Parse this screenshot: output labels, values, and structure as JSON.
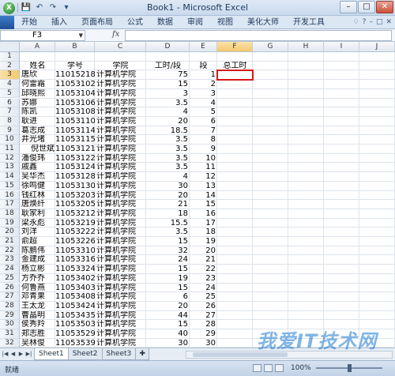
{
  "window": {
    "title": "Book1 - Microsoft Excel",
    "logo_letter": "X",
    "controls": {
      "minimize": "–",
      "maximize": "□",
      "close": "✕"
    }
  },
  "quick_access": {
    "save": "💾",
    "undo": "↶",
    "redo": "↷",
    "more": "▾"
  },
  "ribbon": {
    "tabs": [
      "开始",
      "插入",
      "页面布局",
      "公式",
      "数据",
      "审阅",
      "视图",
      "美化大师",
      "开发工具"
    ],
    "right_icons": [
      "♢",
      "?",
      "–",
      "□",
      "✕"
    ]
  },
  "formula_bar": {
    "name_box": "F3",
    "fx_label": "fx",
    "formula": ""
  },
  "columns": [
    "A",
    "B",
    "C",
    "D",
    "E",
    "F",
    "G",
    "H",
    "I",
    "J"
  ],
  "selected_column": "F",
  "selected_row": 3,
  "rows": [
    [
      "",
      "",
      "",
      "",
      "",
      ""
    ],
    [
      "姓名",
      "学号",
      "学院",
      "工时/段",
      "段",
      "总工时"
    ],
    [
      "唐欣",
      "11015218",
      "计算机学院",
      "75",
      "1",
      ""
    ],
    [
      "何雷霜",
      "11053102",
      "计算机学院",
      "15",
      "2",
      ""
    ],
    [
      "邱晓熙",
      "11053104",
      "计算机学院",
      "3",
      "3",
      ""
    ],
    [
      "苏娜",
      "11053106",
      "计算机学院",
      "3.5",
      "4",
      ""
    ],
    [
      "陈凯",
      "11053108",
      "计算机学院",
      "4",
      "5",
      ""
    ],
    [
      "耿进",
      "11053110",
      "计算机学院",
      "20",
      "6",
      ""
    ],
    [
      "葛志成",
      "11053114",
      "计算机学院",
      "18.5",
      "7",
      ""
    ],
    [
      "井光堵",
      "11053115",
      "计算机学院",
      "3.5",
      "8",
      ""
    ],
    [
      "倪世斌",
      "11053121",
      "计算机学院",
      "3.5",
      "9",
      ""
    ],
    [
      "潘俊玮",
      "11053122",
      "计算机学院",
      "3.5",
      "10",
      ""
    ],
    [
      "戚鑫",
      "11053124",
      "计算机学院",
      "3.5",
      "11",
      ""
    ],
    [
      "吴华杰",
      "11053128",
      "计算机学院",
      "4",
      "12",
      ""
    ],
    [
      "徐鸣健",
      "11053130",
      "计算机学院",
      "30",
      "13",
      ""
    ],
    [
      "钱红林",
      "11053203",
      "计算机学院",
      "20",
      "14",
      ""
    ],
    [
      "唐焕纤",
      "11053205",
      "计算机学院",
      "21",
      "15",
      ""
    ],
    [
      "耿家利",
      "11053212",
      "计算机学院",
      "18",
      "16",
      ""
    ],
    [
      "梁永彪",
      "11053219",
      "计算机学院",
      "15.5",
      "17",
      ""
    ],
    [
      "刘洋",
      "11053222",
      "计算机学院",
      "3.5",
      "18",
      ""
    ],
    [
      "俞超",
      "11053226",
      "计算机学院",
      "15",
      "19",
      ""
    ],
    [
      "陈鹏伟",
      "11053310",
      "计算机学院",
      "32",
      "20",
      ""
    ],
    [
      "金建成",
      "11053316",
      "计算机学院",
      "24",
      "21",
      ""
    ],
    [
      "杨立彬",
      "11053324",
      "计算机学院",
      "15",
      "22",
      ""
    ],
    [
      "方乔乔",
      "11053402",
      "计算机学院",
      "19",
      "23",
      ""
    ],
    [
      "何鲁燕",
      "11053403",
      "计算机学院",
      "15",
      "24",
      ""
    ],
    [
      "邓青果",
      "11053408",
      "计算机学院",
      "6",
      "25",
      ""
    ],
    [
      "王太龙",
      "11053424",
      "计算机学院",
      "20",
      "26",
      ""
    ],
    [
      "曹晶明",
      "11053435",
      "计算机学院",
      "44",
      "27",
      ""
    ],
    [
      "侯秀羚",
      "11053503",
      "计算机学院",
      "15",
      "28",
      ""
    ],
    [
      "郑志胜",
      "11053529",
      "计算机学院",
      "40",
      "29",
      ""
    ],
    [
      "吴林俊",
      "11053539",
      "计算机学院",
      "30",
      "30",
      ""
    ]
  ],
  "sheets": {
    "tabs": [
      "Sheet1",
      "Sheet2",
      "Sheet3"
    ],
    "active": "Sheet1",
    "new_tab": "✚"
  },
  "status": {
    "ready": "就绪",
    "zoom": "100%"
  },
  "watermark": "我爱IT技术网"
}
